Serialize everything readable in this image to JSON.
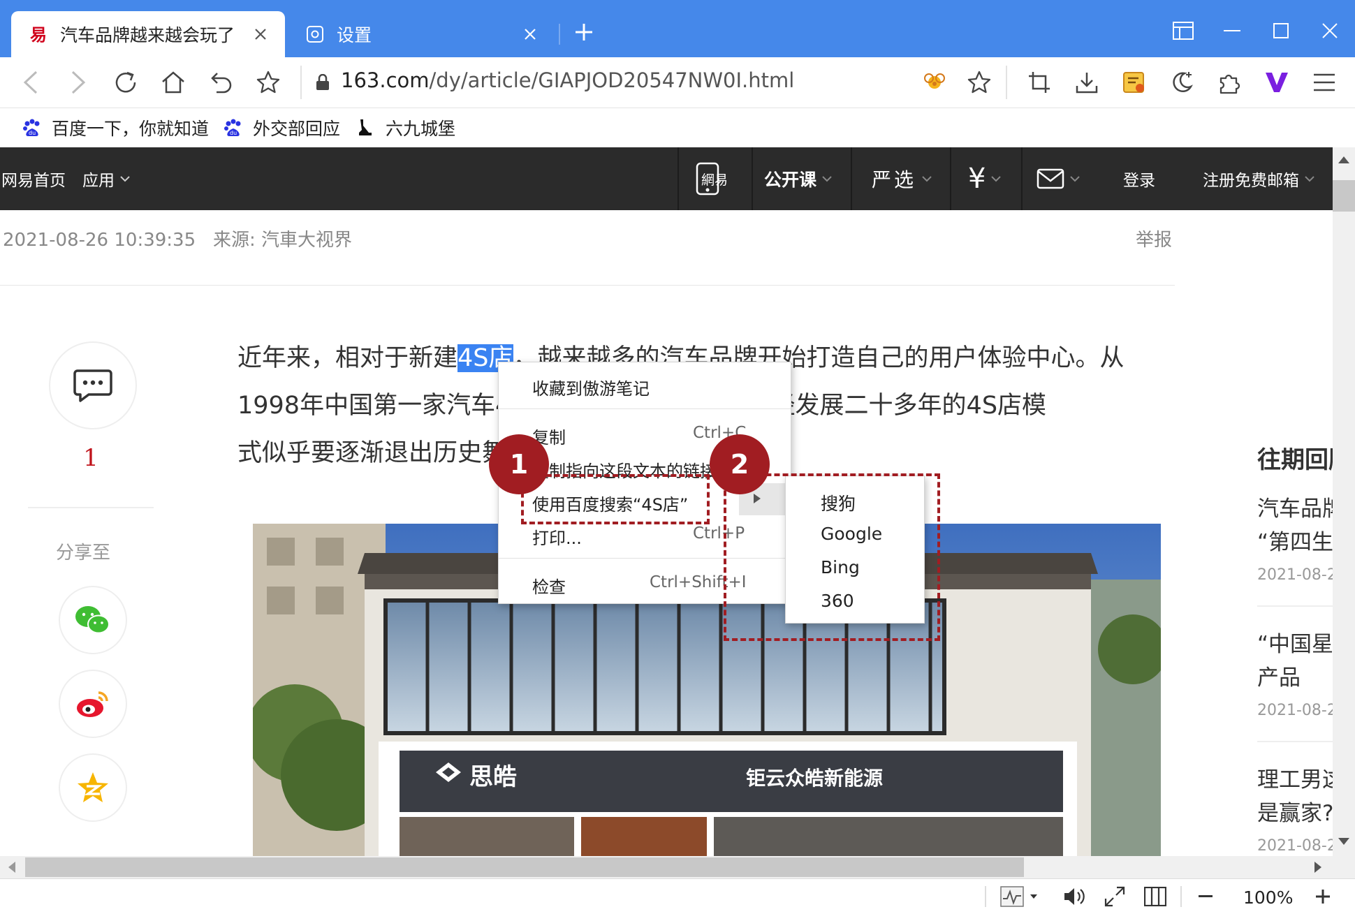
{
  "browser": {
    "tabs": [
      {
        "title": "汽车品牌越来越会玩了",
        "active": true,
        "icon": "netease-icon"
      },
      {
        "title": "设置",
        "active": false,
        "icon": "settings-icon"
      }
    ],
    "address": {
      "domain": "163.com",
      "path": "/dy/article/GIAPJOD20547NW0I.html"
    },
    "bookmarks": [
      {
        "label": "百度一下，你就知道",
        "icon": "baidu-paw-icon"
      },
      {
        "label": "外交部回应",
        "icon": "baidu-paw-icon"
      },
      {
        "label": "六九城堡",
        "icon": "castle-icon"
      }
    ],
    "zoom": "100%"
  },
  "site_nav": {
    "home": "网易首页",
    "apps": "应用",
    "mobile": "網易",
    "open_course": "公开课",
    "yanxuan": "严选",
    "yen": "¥",
    "login": "登录",
    "register": "注册免费邮箱"
  },
  "article": {
    "date": "2021-08-26 10:39:35",
    "source": "来源: 汽車大视界",
    "report": "举报",
    "comment_count": "1",
    "share_label": "分享至",
    "lines": [
      {
        "before": "近年来，相对于新建",
        "selected": "4S店",
        "after": "，越来越多的汽车品牌开始打造自己的用户体验中心。从"
      },
      {
        "text": "1998年中国第一家汽车4S店诞生以来，在中国已经发展二十多年的4S店模"
      },
      {
        "text": "式似乎要逐渐退出历史舞台了。"
      }
    ],
    "photo_signs": {
      "brand": "思皓",
      "dealer": "钜云众皓新能源"
    }
  },
  "sidebar_right": {
    "heading": "往期回顾",
    "items": [
      {
        "line1": "汽车品牌",
        "line2": "“第四生",
        "date": "2021-08-2"
      },
      {
        "line1": "“中国星",
        "line2": "产品",
        "date": "2021-08-2"
      },
      {
        "line1": "理工男这",
        "line2": "是赢家?",
        "date": "2021-08-2"
      }
    ]
  },
  "context_menu": {
    "items": [
      {
        "label": "收藏到傲游笔记",
        "shortcut": ""
      },
      {
        "label": "复制",
        "shortcut": "Ctrl+C"
      },
      {
        "label": "复制指向这段文本的链接",
        "shortcut": ""
      },
      {
        "label": "使用百度搜索“4S店”",
        "shortcut": ""
      },
      {
        "label": "打印...",
        "shortcut": "Ctrl+P"
      },
      {
        "label": "检查",
        "shortcut": "Ctrl+Shift+I"
      }
    ],
    "submenu": [
      "搜狗",
      "Google",
      "Bing",
      "360"
    ]
  },
  "callouts": {
    "first": "1",
    "second": "2"
  },
  "colors": {
    "titlebar": "#4588ea",
    "callout": "#a11d22",
    "selection": "#3a83f2",
    "site_nav": "#2b2b2b"
  }
}
